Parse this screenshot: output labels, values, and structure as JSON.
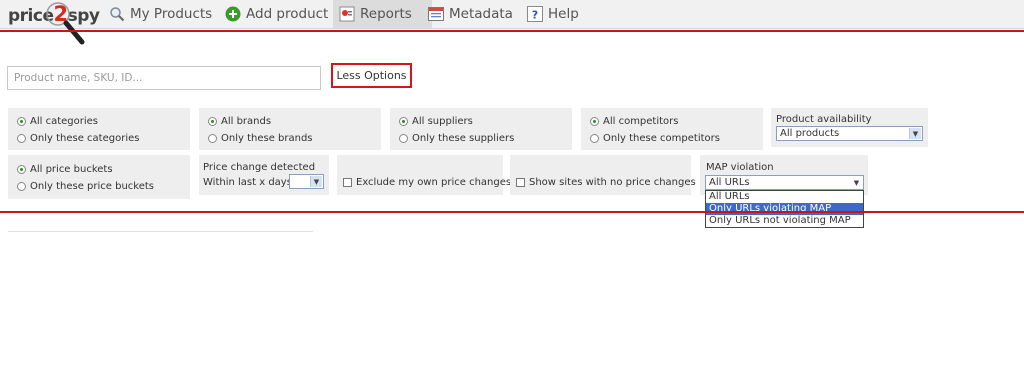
{
  "nav": {
    "logo_text_a": "price",
    "logo_text_b": "2",
    "logo_text_c": "spy",
    "items": [
      {
        "label": "My Products",
        "icon": "magnifier-icon"
      },
      {
        "label": "Add product",
        "icon": "plus-circle-icon"
      },
      {
        "label": "Reports",
        "icon": "reports-icon"
      },
      {
        "label": "Metadata",
        "icon": "metadata-icon"
      },
      {
        "label": "Help",
        "icon": "help-icon"
      }
    ],
    "active": "Reports"
  },
  "search": {
    "placeholder": "Product name, SKU, ID..."
  },
  "options_button": "Less Options",
  "filters": {
    "categories": {
      "all": "All categories",
      "only": "Only these categories"
    },
    "brands": {
      "all": "All brands",
      "only": "Only these brands"
    },
    "suppliers": {
      "all": "All suppliers",
      "only": "Only these suppliers"
    },
    "competitors": {
      "all": "All competitors",
      "only": "Only these competitors"
    },
    "availability": {
      "label": "Product availability",
      "value": "All products"
    },
    "price_buckets": {
      "all": "All price buckets",
      "only": "Only these price buckets"
    },
    "price_change": {
      "label": "Price change detected",
      "sublabel": "Within last x days:",
      "value": ""
    },
    "exclude_own": "Exclude my own price changes",
    "no_price_changes": "Show sites with no price changes",
    "map_violation": {
      "label": "MAP violation",
      "value": "All URLs",
      "options": [
        "All URLs",
        "Only URLs violating MAP",
        "Only URLs not violating MAP"
      ],
      "highlighted": "Only URLs violating MAP"
    }
  },
  "colors": {
    "accent_red": "#c8141b",
    "selected_blue": "#3b6ac8",
    "radio_green": "#2a8a2a"
  }
}
